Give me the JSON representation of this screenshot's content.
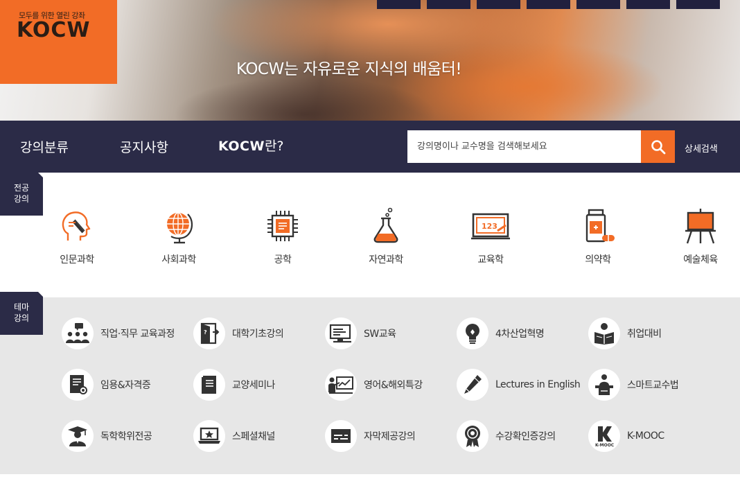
{
  "logo": {
    "tagline": "모두를 위한 열린 강좌",
    "name": "KOCW"
  },
  "hero": {
    "title": "KOCW는 자유로운 지식의 배움터!"
  },
  "nav": {
    "items": [
      "강의분류",
      "공지사항"
    ],
    "kocw_brand": "KOCW",
    "kocw_suffix": "란?",
    "search_placeholder": "강의명이나 교수명을 검색해보세요",
    "detail_search": "상세검색"
  },
  "majors": {
    "section_label_line1": "전공",
    "section_label_line2": "강의",
    "items": [
      {
        "label": "인문과학",
        "icon": "head-pen-icon"
      },
      {
        "label": "사회과학",
        "icon": "globe-icon"
      },
      {
        "label": "공학",
        "icon": "chip-icon"
      },
      {
        "label": "자연과학",
        "icon": "flask-icon"
      },
      {
        "label": "교육학",
        "icon": "blackboard-icon"
      },
      {
        "label": "의약학",
        "icon": "medicine-icon"
      },
      {
        "label": "예술체육",
        "icon": "easel-icon"
      }
    ]
  },
  "themes": {
    "section_label_line1": "테마",
    "section_label_line2": "강의",
    "items": [
      {
        "label": "직업·직무 교육과정",
        "icon": "people-chat-icon"
      },
      {
        "label": "대학기초강의",
        "icon": "door-icon"
      },
      {
        "label": "SW교육",
        "icon": "monitor-icon"
      },
      {
        "label": "4차산업혁명",
        "icon": "bulb-icon"
      },
      {
        "label": "취업대비",
        "icon": "reader-icon"
      },
      {
        "label": "임용&자격증",
        "icon": "certificate-icon"
      },
      {
        "label": "교양세미나",
        "icon": "book-icon"
      },
      {
        "label": "영어&해외특강",
        "icon": "presenter-icon"
      },
      {
        "label": "Lectures in English",
        "icon": "pen-icon"
      },
      {
        "label": "스마트교수법",
        "icon": "lectern-icon"
      },
      {
        "label": "독학학위전공",
        "icon": "graduate-icon"
      },
      {
        "label": "스페셜채널",
        "icon": "laptop-star-icon"
      },
      {
        "label": "자막제공강의",
        "icon": "caption-icon"
      },
      {
        "label": "수강확인증강의",
        "icon": "medal-icon"
      },
      {
        "label": "K-MOOC",
        "icon": "kmooc-icon"
      }
    ]
  },
  "colors": {
    "brand_orange": "#f26c26",
    "navy": "#2b2b47",
    "theme_bg": "#e7e7e7"
  }
}
